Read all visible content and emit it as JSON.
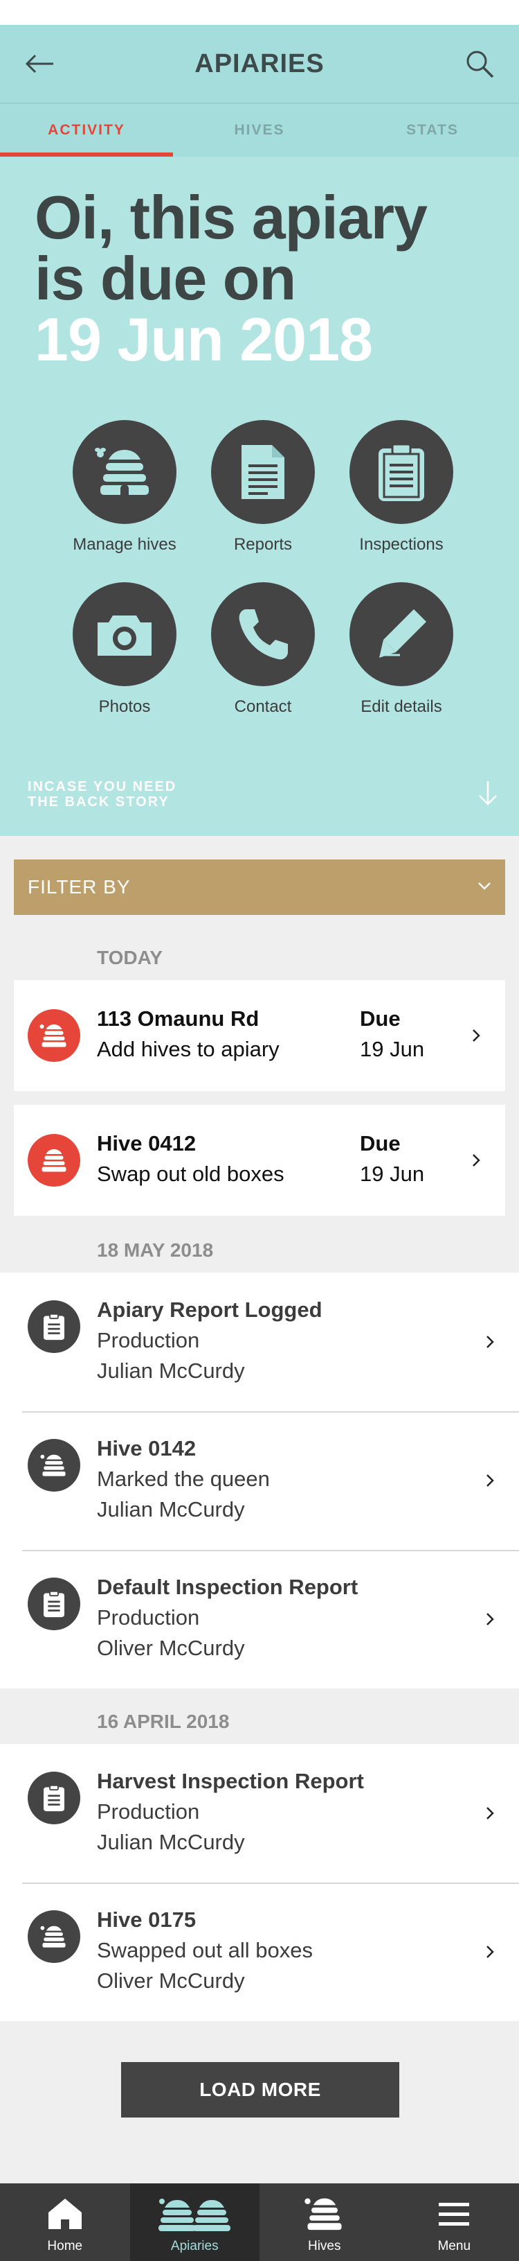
{
  "header": {
    "title": "APIARIES",
    "back_icon": "arrow-left-icon",
    "search_icon": "search-icon"
  },
  "tabs": [
    {
      "label": "ACTIVITY",
      "active": true
    },
    {
      "label": "HIVES",
      "active": false
    },
    {
      "label": "STATS",
      "active": false
    }
  ],
  "hero": {
    "line1": "Oi, this apiary",
    "line2": "is due on",
    "date": "19 Jun 2018",
    "actions": [
      {
        "label": "Manage hives",
        "icon": "beehive-icon"
      },
      {
        "label": "Reports",
        "icon": "document-icon"
      },
      {
        "label": "Inspections",
        "icon": "clipboard-icon"
      },
      {
        "label": "Photos",
        "icon": "camera-icon"
      },
      {
        "label": "Contact",
        "icon": "phone-icon"
      },
      {
        "label": "Edit details",
        "icon": "pencil-icon"
      }
    ],
    "backstory_line1": "INCASE YOU NEED",
    "backstory_line2": "THE BACK STORY"
  },
  "filter": {
    "label": "FILTER BY"
  },
  "sections": {
    "today": "TODAY",
    "may": "18 MAY 2018",
    "april": "16 APRIL 2018"
  },
  "due_items": [
    {
      "title": "113 Omaunu Rd",
      "subtitle": "Add hives to apiary",
      "due_label": "Due",
      "due_date": "19 Jun"
    },
    {
      "title": "Hive 0412",
      "subtitle": "Swap out old boxes",
      "due_label": "Due",
      "due_date": "19 Jun"
    }
  ],
  "may_items": [
    {
      "title": "Apiary Report Logged",
      "subtitle": "Production",
      "person": "Julian McCurdy",
      "icon": "clipboard-icon"
    },
    {
      "title": "Hive 0142",
      "subtitle": "Marked the queen",
      "person": "Julian McCurdy",
      "icon": "beehive-icon"
    },
    {
      "title": "Default Inspection Report",
      "subtitle": "Production",
      "person": "Oliver McCurdy",
      "icon": "clipboard-icon"
    }
  ],
  "april_items": [
    {
      "title": "Harvest Inspection Report",
      "subtitle": "Production",
      "person": "Julian McCurdy",
      "icon": "clipboard-icon"
    },
    {
      "title": "Hive 0175",
      "subtitle": "Swapped out all boxes",
      "person": "Oliver McCurdy",
      "icon": "beehive-icon"
    }
  ],
  "load_more": "LOAD MORE",
  "bottom_nav": [
    {
      "label": "Home",
      "icon": "home-icon",
      "active": false
    },
    {
      "label": "Apiaries",
      "icon": "apiaries-icon",
      "active": true
    },
    {
      "label": "Hives",
      "icon": "beehive-icon",
      "active": false
    },
    {
      "label": "Menu",
      "icon": "menu-icon",
      "active": false
    }
  ],
  "colors": {
    "teal": "#a5dcdc",
    "hero": "#b2e4e2",
    "accent_red": "#e6463a",
    "filter_gold": "#bd9f6b",
    "dark": "#444444"
  }
}
